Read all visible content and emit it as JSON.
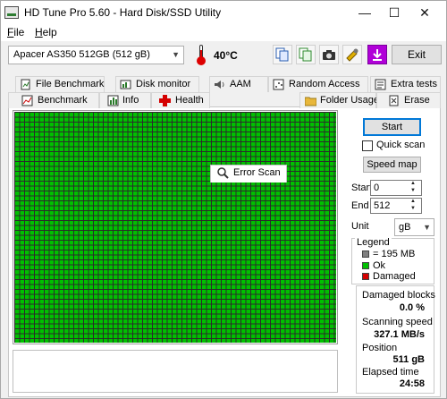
{
  "window": {
    "title": "HD Tune Pro 5.60 - Hard Disk/SSD Utility",
    "minimize_glyph": "—",
    "maximize_glyph": "☐",
    "close_glyph": "✕"
  },
  "menu": [
    "File",
    "Help"
  ],
  "toolbar": {
    "drive": "Apacer AS350 512GB (512 gB)",
    "temperature": "40",
    "temperature_unit": "°C",
    "exit_label": "Exit",
    "icons": [
      "copy-info-icon",
      "copy-text-icon",
      "camera-icon",
      "options-icon",
      "save-icon"
    ]
  },
  "tabs": {
    "row1": [
      "File Benchmark",
      "Disk monitor",
      "AAM",
      "Random Access",
      "Extra tests"
    ],
    "row2": [
      "Benchmark",
      "Info",
      "Health",
      "Error Scan",
      "Folder Usage",
      "Erase"
    ],
    "active": "Error Scan"
  },
  "scan": {
    "progress_fraction": 1.0,
    "block_color": "#00c000"
  },
  "controls": {
    "start_label": "Start",
    "quick_scan_label": "Quick scan",
    "quick_scan_checked": false,
    "speed_map_label": "Speed map",
    "start_field_label": "Start",
    "start_value": "0",
    "end_field_label": "End",
    "end_value": "512",
    "unit_label": "Unit",
    "unit_value": "gB"
  },
  "legend": {
    "title": "Legend",
    "block_size": "= 195 MB",
    "ok_label": "Ok",
    "damaged_label": "Damaged",
    "colors": {
      "block": "#808080",
      "ok": "#00c000",
      "damaged": "#d40000"
    }
  },
  "stats": {
    "damaged_blocks_label": "Damaged blocks",
    "damaged_blocks_value": "0.0 %",
    "scanning_speed_label": "Scanning speed",
    "scanning_speed_value": "327.1 MB/s",
    "position_label": "Position",
    "position_value": "511 gB",
    "elapsed_label": "Elapsed time",
    "elapsed_value": "24:58"
  }
}
